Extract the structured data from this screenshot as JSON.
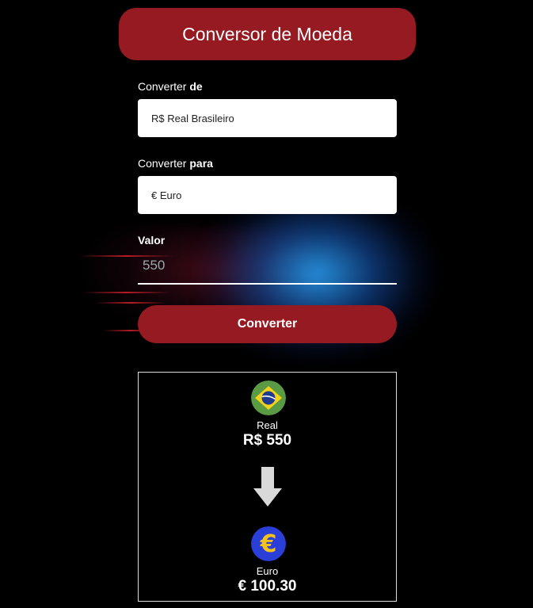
{
  "header": {
    "title": "Conversor de Moeda"
  },
  "form": {
    "from": {
      "label_prefix": "Converter ",
      "label_bold": "de",
      "selected": "R$ Real Brasileiro"
    },
    "to": {
      "label_prefix": "Converter ",
      "label_bold": "para",
      "selected": "€ Euro"
    },
    "value": {
      "label": "Valor",
      "placeholder": "550"
    },
    "convert_label": "Converter"
  },
  "result": {
    "from": {
      "name": "Real",
      "amount": "R$ 550",
      "icon": "brazil-flag-icon"
    },
    "to": {
      "name": "Euro",
      "amount": "€ 100.30",
      "icon": "euro-icon"
    },
    "arrow_icon": "arrow-down-icon"
  },
  "colors": {
    "accent": "#951a22",
    "background": "#000000",
    "euro_blue": "#2a3fd8",
    "euro_gold": "#f4c21a",
    "brazil_green": "#5b9a44",
    "brazil_yellow": "#f2d21a",
    "brazil_blue": "#1f3a8f"
  }
}
